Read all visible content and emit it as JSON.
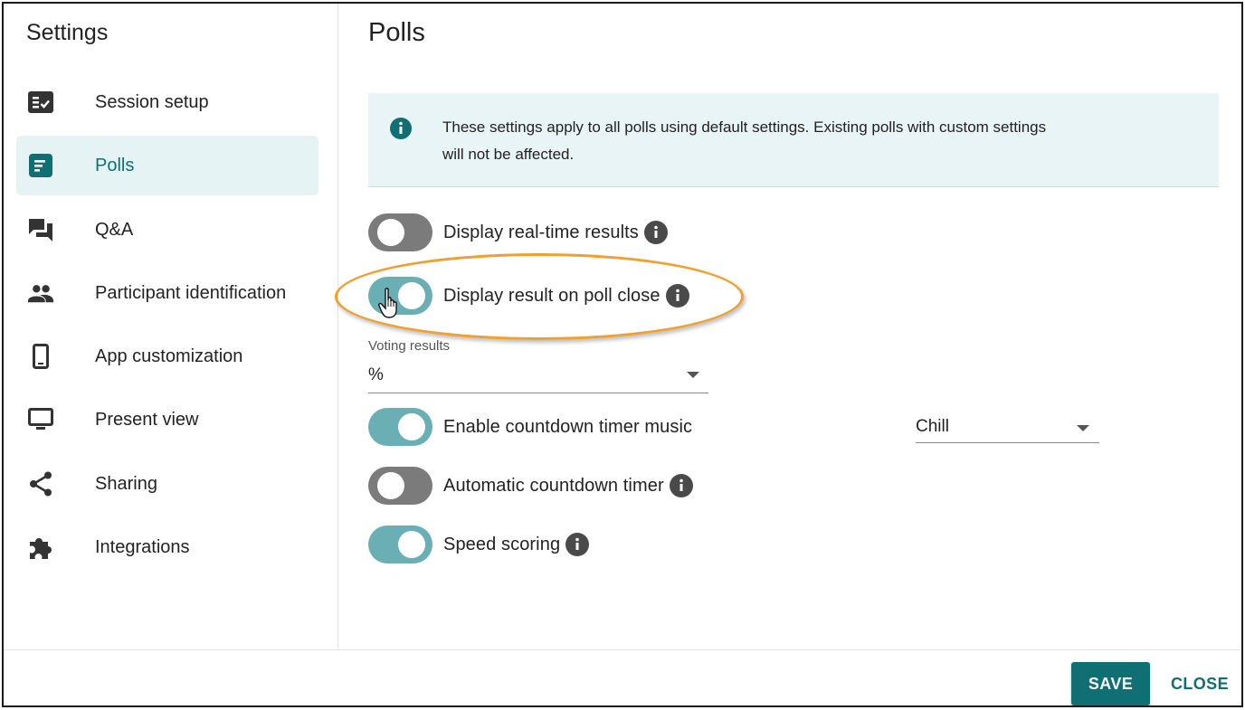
{
  "sidebar": {
    "title": "Settings",
    "items": [
      {
        "label": "Session setup",
        "icon": "checklist-icon"
      },
      {
        "label": "Polls",
        "icon": "poll-icon",
        "active": true
      },
      {
        "label": "Q&A",
        "icon": "chat-bubbles-icon"
      },
      {
        "label": "Participant identification",
        "icon": "people-icon"
      },
      {
        "label": "App customization",
        "icon": "phone-icon"
      },
      {
        "label": "Present view",
        "icon": "monitor-icon"
      },
      {
        "label": "Sharing",
        "icon": "share-icon"
      },
      {
        "label": "Integrations",
        "icon": "puzzle-icon"
      }
    ]
  },
  "main": {
    "title": "Polls",
    "info": {
      "icon": "info-icon",
      "text": "These settings apply to all polls using default settings. Existing polls with custom settings will not be affected."
    },
    "settings": {
      "realtime": {
        "label": "Display real-time results",
        "on": false,
        "help": true
      },
      "on_close": {
        "label": "Display result on poll close",
        "on": true,
        "help": true
      },
      "countdown_music": {
        "label": "Enable countdown timer music",
        "on": true,
        "help": false
      },
      "auto_countdown": {
        "label": "Automatic countdown timer",
        "on": false,
        "help": true
      },
      "speed_scoring": {
        "label": "Speed scoring",
        "on": true,
        "help": true
      }
    },
    "voting_results": {
      "caption": "Voting results",
      "value": "%"
    },
    "music_select": {
      "value": "Chill"
    }
  },
  "footer": {
    "save_label": "SAVE",
    "close_label": "CLOSE"
  },
  "colors": {
    "accent": "#0f6f72",
    "toggle_on": "#6aafb4",
    "toggle_off": "#7b7b7b",
    "info_bg": "#e8f4f5",
    "active_nav_bg": "#e6f3f4",
    "highlight": "#f0a030"
  }
}
